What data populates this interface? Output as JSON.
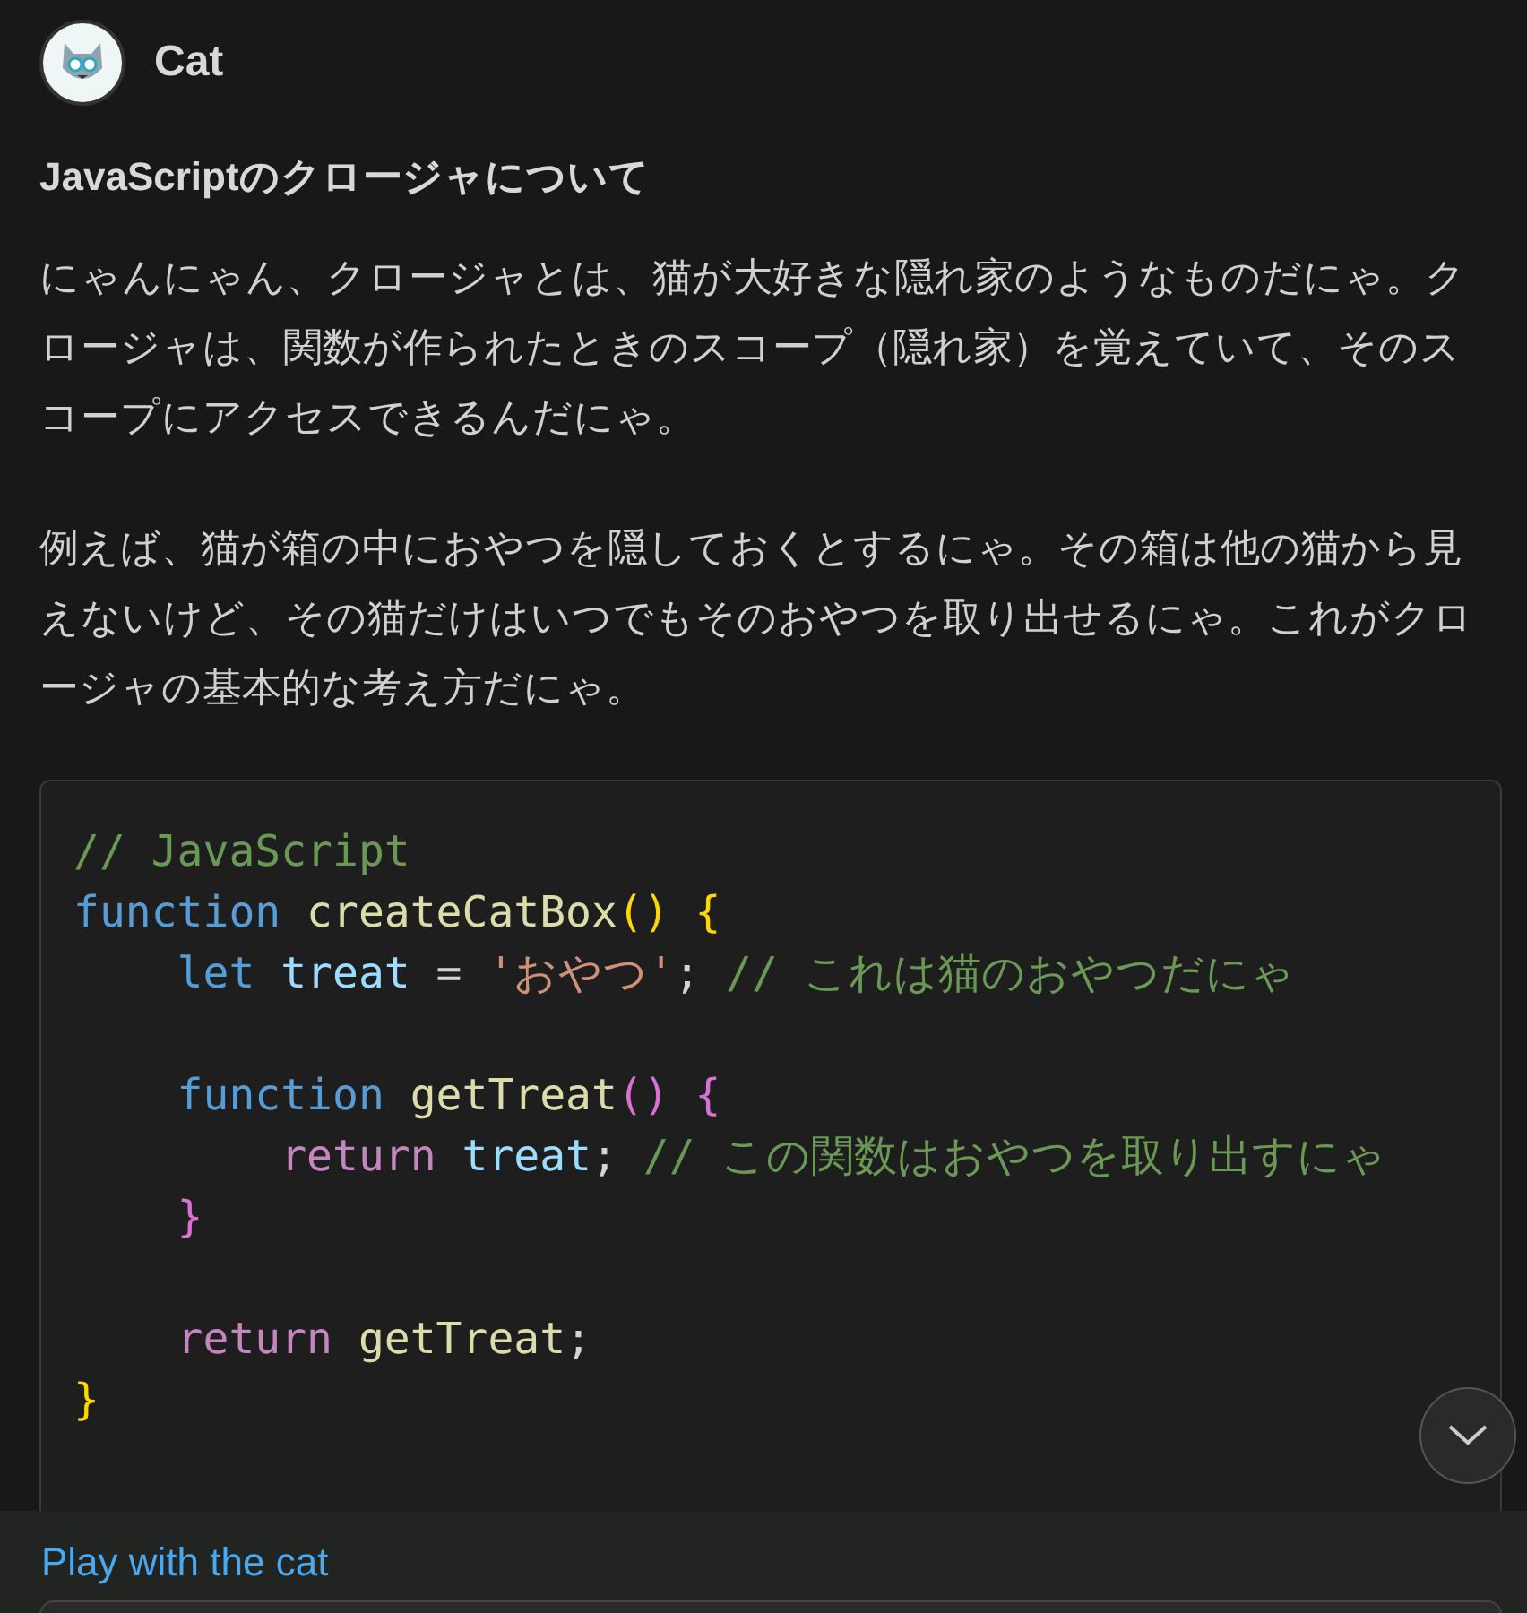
{
  "header": {
    "name": "Cat"
  },
  "title": "JavaScriptのクロージャについて",
  "paragraphs": [
    "にゃんにゃん、クロージャとは、猫が大好きな隠れ家のようなものだにゃ。クロージャは、関数が作られたときのスコープ（隠れ家）を覚えていて、そのスコープにアクセスできるんだにゃ。",
    "例えば、猫が箱の中におやつを隠しておくとするにゃ。その箱は他の猫から見えないけど、その猫だけはいつでもそのおやつを取り出せるにゃ。これがクロージャの基本的な考え方だにゃ。"
  ],
  "code": {
    "lines": [
      {
        "kind": "code",
        "tokens": [
          {
            "kind": "comment",
            "text": "// JavaScript"
          }
        ]
      },
      {
        "kind": "code",
        "tokens": [
          {
            "kind": "storage",
            "text": "function "
          },
          {
            "kind": "func",
            "text": "createCatBox"
          },
          {
            "kind": "bracket1",
            "text": "() {"
          }
        ]
      },
      {
        "kind": "code",
        "tokens": [
          {
            "kind": "storage",
            "text": "    let "
          },
          {
            "kind": "var",
            "text": "treat"
          },
          {
            "kind": "plain",
            "text": " = "
          },
          {
            "kind": "string",
            "text": "'おやつ'"
          },
          {
            "kind": "plain",
            "text": "; "
          },
          {
            "kind": "comment",
            "text": "// これは猫のおやつだにゃ"
          }
        ]
      },
      {
        "kind": "blank"
      },
      {
        "kind": "code",
        "tokens": [
          {
            "kind": "storage",
            "text": "    function "
          },
          {
            "kind": "func",
            "text": "getTreat"
          },
          {
            "kind": "bracket2",
            "text": "() {"
          }
        ]
      },
      {
        "kind": "code",
        "tokens": [
          {
            "kind": "control",
            "text": "        return "
          },
          {
            "kind": "var",
            "text": "treat"
          },
          {
            "kind": "plain",
            "text": "; "
          },
          {
            "kind": "comment",
            "text": "// この関数はおやつを取り出すにゃ"
          }
        ]
      },
      {
        "kind": "code",
        "tokens": [
          {
            "kind": "bracket2",
            "text": "    }"
          }
        ]
      },
      {
        "kind": "blank"
      },
      {
        "kind": "code",
        "tokens": [
          {
            "kind": "control",
            "text": "    return "
          },
          {
            "kind": "func",
            "text": "getTreat"
          },
          {
            "kind": "plain",
            "text": ";"
          }
        ]
      },
      {
        "kind": "code",
        "tokens": [
          {
            "kind": "bracket1",
            "text": "}"
          }
        ]
      }
    ]
  },
  "footer": {
    "link": "Play with the cat"
  }
}
